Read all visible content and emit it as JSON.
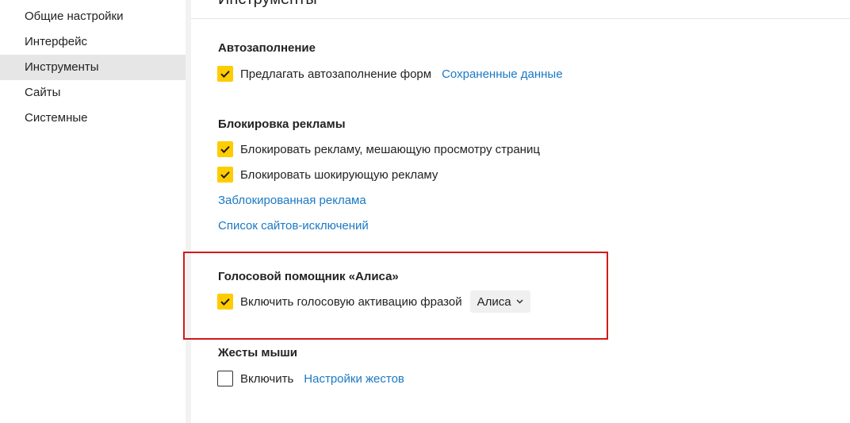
{
  "sidebar": {
    "items": [
      {
        "label": "Общие настройки"
      },
      {
        "label": "Интерфейс"
      },
      {
        "label": "Инструменты"
      },
      {
        "label": "Сайты"
      },
      {
        "label": "Системные"
      }
    ],
    "active_index": 2
  },
  "main": {
    "page_title": "Инструменты",
    "autofill": {
      "title": "Автозаполнение",
      "offer_autofill": {
        "label": "Предлагать автозаполнение форм",
        "checked": true
      },
      "saved_data_link": "Сохраненные данные"
    },
    "adblock": {
      "title": "Блокировка рекламы",
      "block_intrusive": {
        "label": "Блокировать рекламу, мешающую просмотру страниц",
        "checked": true
      },
      "block_shocking": {
        "label": "Блокировать шокирующую рекламу",
        "checked": true
      },
      "blocked_ads_link": "Заблокированная реклама",
      "exceptions_link": "Список сайтов-исключений"
    },
    "voice_assistant": {
      "title": "Голосовой помощник «Алиса»",
      "voice_activation": {
        "label": "Включить голосовую активацию фразой",
        "checked": true
      },
      "phrase_select": {
        "selected": "Алиса"
      }
    },
    "mouse_gestures": {
      "title": "Жесты мыши",
      "enable": {
        "label": "Включить",
        "checked": false
      },
      "gesture_settings_link": "Настройки жестов"
    }
  },
  "colors": {
    "checkbox_checked": "#ffcc00",
    "link": "#1b79c4",
    "highlight_border": "#d0191b",
    "active_sidebar": "#e6e6e6"
  },
  "icons": {
    "check": "check-icon",
    "dropdown": "chevron-down-icon"
  }
}
